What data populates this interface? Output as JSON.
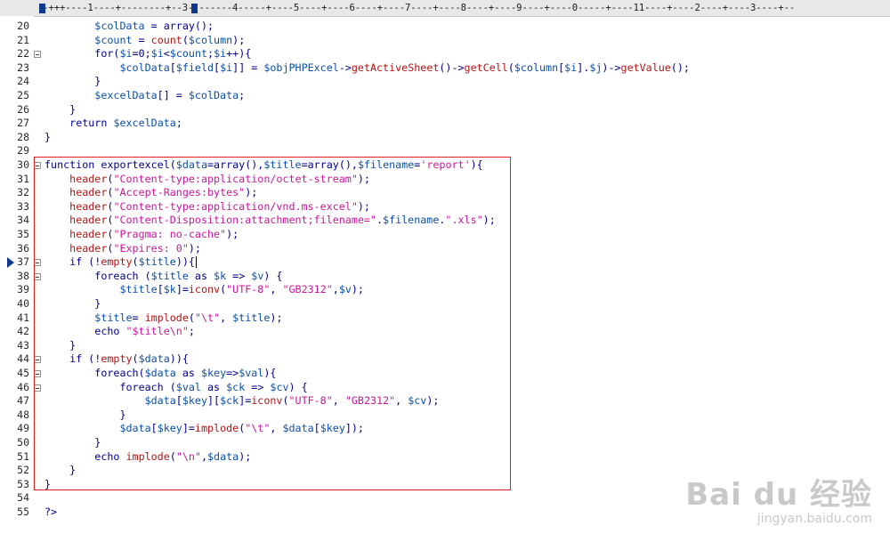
{
  "ruler": {
    "text": "--+++----1----+--------+--3--------4-----+----5----+----6----+----7----+----8----+----9----+----0-----+----11----+----2----+----3----+--"
  },
  "colors": {
    "variable": "#0b4fa8",
    "string": "#c8189b",
    "function": "#b01515",
    "keyword": "#00008b",
    "highlight_border": "#e02020"
  },
  "editor": {
    "current_line": 37,
    "lines": [
      {
        "num": "20",
        "fold": false,
        "code": "        $colData = array();"
      },
      {
        "num": "21",
        "fold": false,
        "code": "        $count = count($column);"
      },
      {
        "num": "22",
        "fold": true,
        "code": "        for($i=0;$i<$count;$i++){"
      },
      {
        "num": "23",
        "fold": false,
        "code": "            $colData[$field[$i]] = $objPHPExcel->getActiveSheet()->getCell($column[$i].$j)->getValue();"
      },
      {
        "num": "24",
        "fold": false,
        "code": "        }"
      },
      {
        "num": "25",
        "fold": false,
        "code": "        $excelData[] = $colData;"
      },
      {
        "num": "26",
        "fold": false,
        "code": "    }"
      },
      {
        "num": "27",
        "fold": false,
        "code": "    return $excelData;"
      },
      {
        "num": "28",
        "fold": false,
        "code": "}"
      },
      {
        "num": "29",
        "fold": false,
        "code": ""
      },
      {
        "num": "30",
        "fold": true,
        "code": "function exportexcel($data=array(),$title=array(),$filename='report'){"
      },
      {
        "num": "31",
        "fold": false,
        "code": "    header(\"Content-type:application/octet-stream\");"
      },
      {
        "num": "32",
        "fold": false,
        "code": "    header(\"Accept-Ranges:bytes\");"
      },
      {
        "num": "33",
        "fold": false,
        "code": "    header(\"Content-type:application/vnd.ms-excel\");"
      },
      {
        "num": "34",
        "fold": false,
        "code": "    header(\"Content-Disposition:attachment;filename=\".$filename.\".xls\");"
      },
      {
        "num": "35",
        "fold": false,
        "code": "    header(\"Pragma: no-cache\");"
      },
      {
        "num": "36",
        "fold": false,
        "code": "    header(\"Expires: 0\");"
      },
      {
        "num": "37",
        "fold": true,
        "code": "    if (!empty($title)){"
      },
      {
        "num": "38",
        "fold": true,
        "code": "        foreach ($title as $k => $v) {"
      },
      {
        "num": "39",
        "fold": false,
        "code": "            $title[$k]=iconv(\"UTF-8\", \"GB2312\",$v);"
      },
      {
        "num": "40",
        "fold": false,
        "code": "        }"
      },
      {
        "num": "41",
        "fold": false,
        "code": "        $title= implode(\"\\t\", $title);"
      },
      {
        "num": "42",
        "fold": false,
        "code": "        echo \"$title\\n\";"
      },
      {
        "num": "43",
        "fold": false,
        "code": "    }"
      },
      {
        "num": "44",
        "fold": true,
        "code": "    if (!empty($data)){"
      },
      {
        "num": "45",
        "fold": true,
        "code": "        foreach($data as $key=>$val){"
      },
      {
        "num": "46",
        "fold": true,
        "code": "            foreach ($val as $ck => $cv) {"
      },
      {
        "num": "47",
        "fold": false,
        "code": "                $data[$key][$ck]=iconv(\"UTF-8\", \"GB2312\", $cv);"
      },
      {
        "num": "48",
        "fold": false,
        "code": "            }"
      },
      {
        "num": "49",
        "fold": false,
        "code": "            $data[$key]=implode(\"\\t\", $data[$key]);"
      },
      {
        "num": "50",
        "fold": false,
        "code": "        }"
      },
      {
        "num": "51",
        "fold": false,
        "code": "        echo implode(\"\\n\",$data);"
      },
      {
        "num": "52",
        "fold": false,
        "code": "    }"
      },
      {
        "num": "53",
        "fold": false,
        "code": "}"
      },
      {
        "num": "54",
        "fold": false,
        "code": ""
      },
      {
        "num": "55",
        "fold": false,
        "code": "?>"
      }
    ]
  },
  "watermark": {
    "logo": "Bai du 经验",
    "url": "jingyan.baidu.com"
  }
}
